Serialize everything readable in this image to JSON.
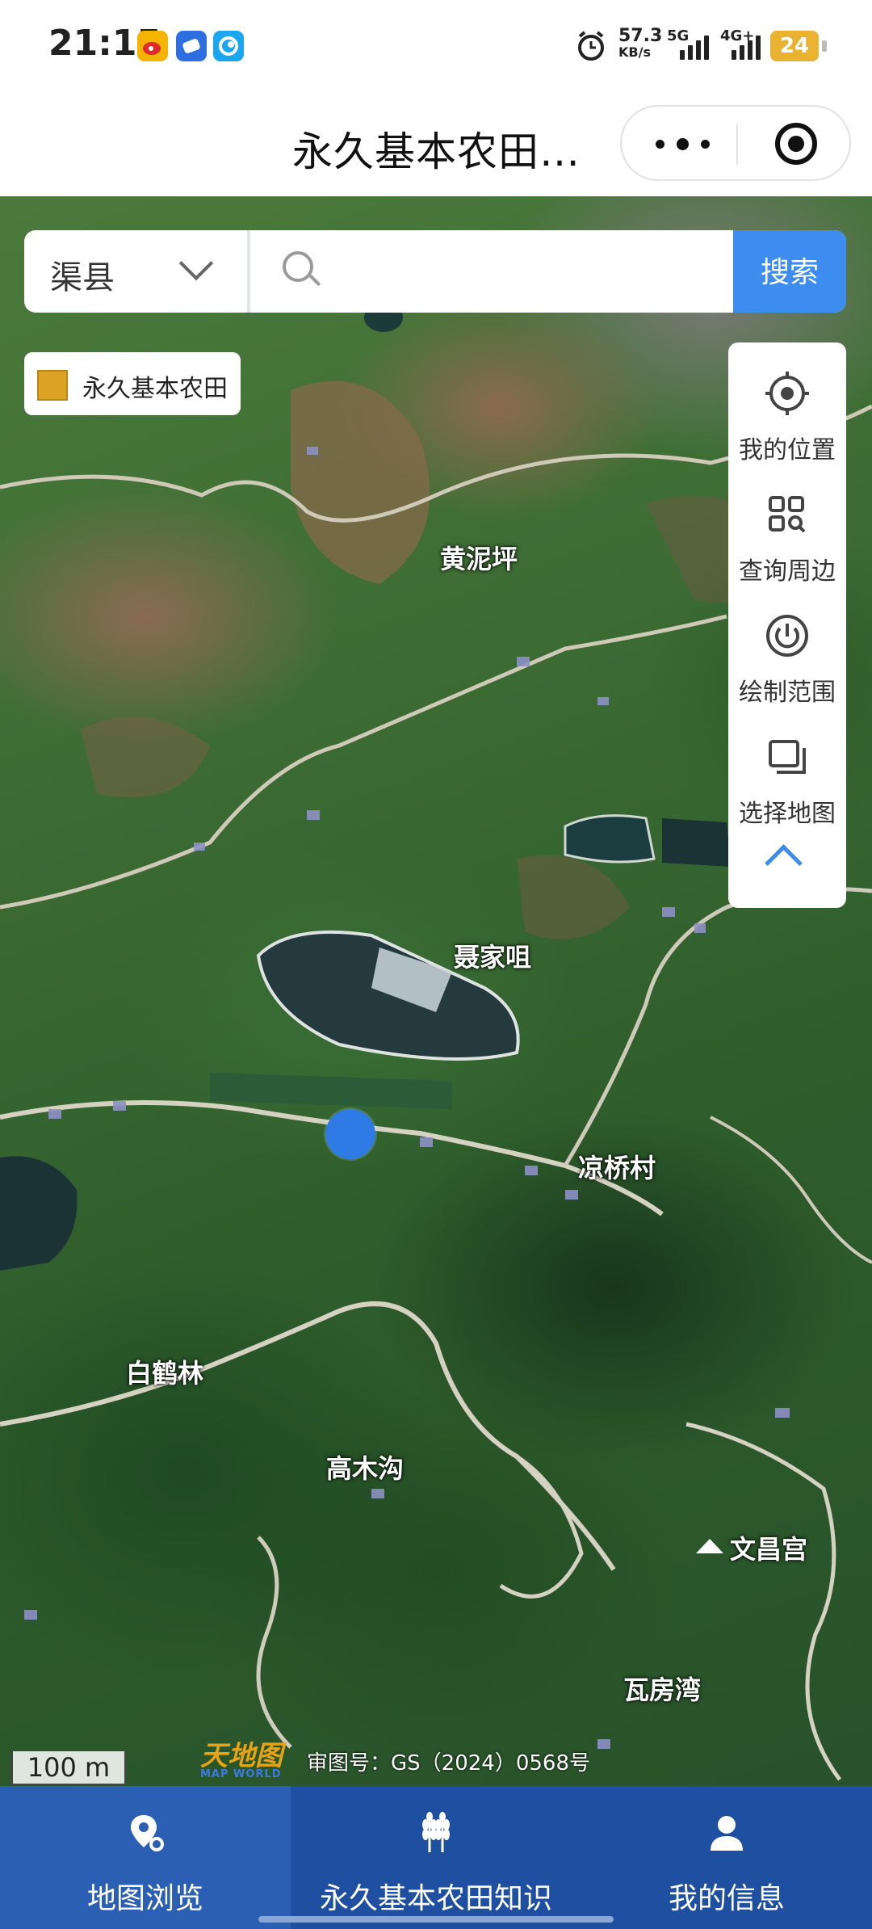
{
  "status_bar": {
    "time": "21:15",
    "speed_value": "57.3",
    "speed_unit": "KB/s",
    "net1": "5G",
    "net2": "4G+",
    "battery": "24",
    "icons": [
      "weibo-app-icon",
      "blue-app-icon",
      "cyan-app-icon",
      "alarm-icon"
    ]
  },
  "header": {
    "title": "永久基本农田…",
    "more_icon": "more-dots-icon",
    "close_icon": "target-circle-icon"
  },
  "search": {
    "county": "渠县",
    "placeholder": "",
    "button": "搜索"
  },
  "legend": {
    "label": "永久基本农田",
    "color": "#dca324"
  },
  "tools": [
    {
      "label": "我的位置",
      "icon": "locate-icon"
    },
    {
      "label": "查询周边",
      "icon": "grid-search-icon"
    },
    {
      "label": "绘制范围",
      "icon": "draw-range-icon"
    },
    {
      "label": "选择地图",
      "icon": "layers-icon"
    }
  ],
  "map": {
    "places": {
      "p1": "黄泥坪",
      "p2": "聂家咀",
      "p3": "凉桥村",
      "p4": "白鹤林",
      "p5": "高木沟",
      "p6": "文昌宫",
      "p7": "瓦房湾"
    },
    "scale": "100 m",
    "logo_cn": "天地图",
    "logo_en": "MAP WORLD",
    "copyright": "审图号：GS（2024）0568号"
  },
  "nav": [
    {
      "label": "地图浏览",
      "icon": "map-pin-icon",
      "active": true
    },
    {
      "label": "永久基本农田知识",
      "icon": "wheat-icon",
      "active": false
    },
    {
      "label": "我的信息",
      "icon": "user-icon",
      "active": false
    }
  ],
  "colors": {
    "accent": "#3d8cf0",
    "nav_bg": "#1e4fa0",
    "location_dot": "#2f7be6"
  }
}
